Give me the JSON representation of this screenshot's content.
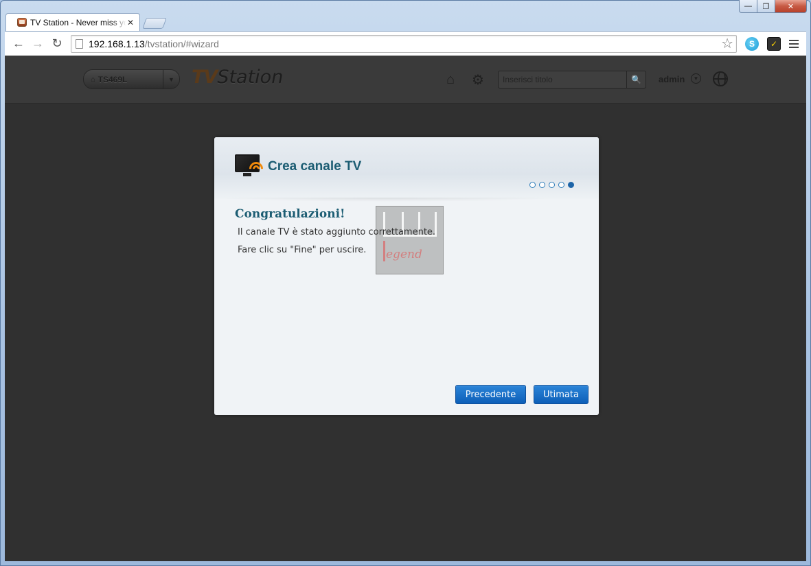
{
  "window": {
    "tab_title": "TV Station - Never miss your favorite TV shows",
    "tab_close": "✕",
    "controls": {
      "minimize": "—",
      "maximize": "❐",
      "close": "✕"
    }
  },
  "toolbar": {
    "back": "←",
    "forward": "→",
    "reload": "↻",
    "url_host": "192.168.1.13",
    "url_path": "/tvstation/#wizard",
    "star": "☆",
    "ext_skype": "S",
    "ext_check": "✓"
  },
  "app": {
    "nas_name": "TS469L",
    "nas_home": "⌂",
    "nas_arrow": "▼",
    "logo_tv": "TV",
    "logo_station": "Station",
    "home": "⌂",
    "settings": "⚙",
    "search_placeholder": "Inserisci titolo",
    "search_btn": "🔍",
    "user": "admin",
    "user_caret": "▼"
  },
  "dialog": {
    "title": "Crea canale TV",
    "steps": [
      {
        "active": false
      },
      {
        "active": false
      },
      {
        "active": false
      },
      {
        "active": false
      },
      {
        "active": true
      }
    ],
    "heading": "Congratulazioni!",
    "line1": "Il canale TV è stato aggiunto correttamente.",
    "line2": "Fare clic su \"Fine\" per uscire.",
    "watermark_text": "egend",
    "btn_prev": "Precedente",
    "btn_finish": "Utimata"
  },
  "colors": {
    "accent": "#1c5d73",
    "button": "#0d5fb8",
    "page_bg": "#303030"
  }
}
